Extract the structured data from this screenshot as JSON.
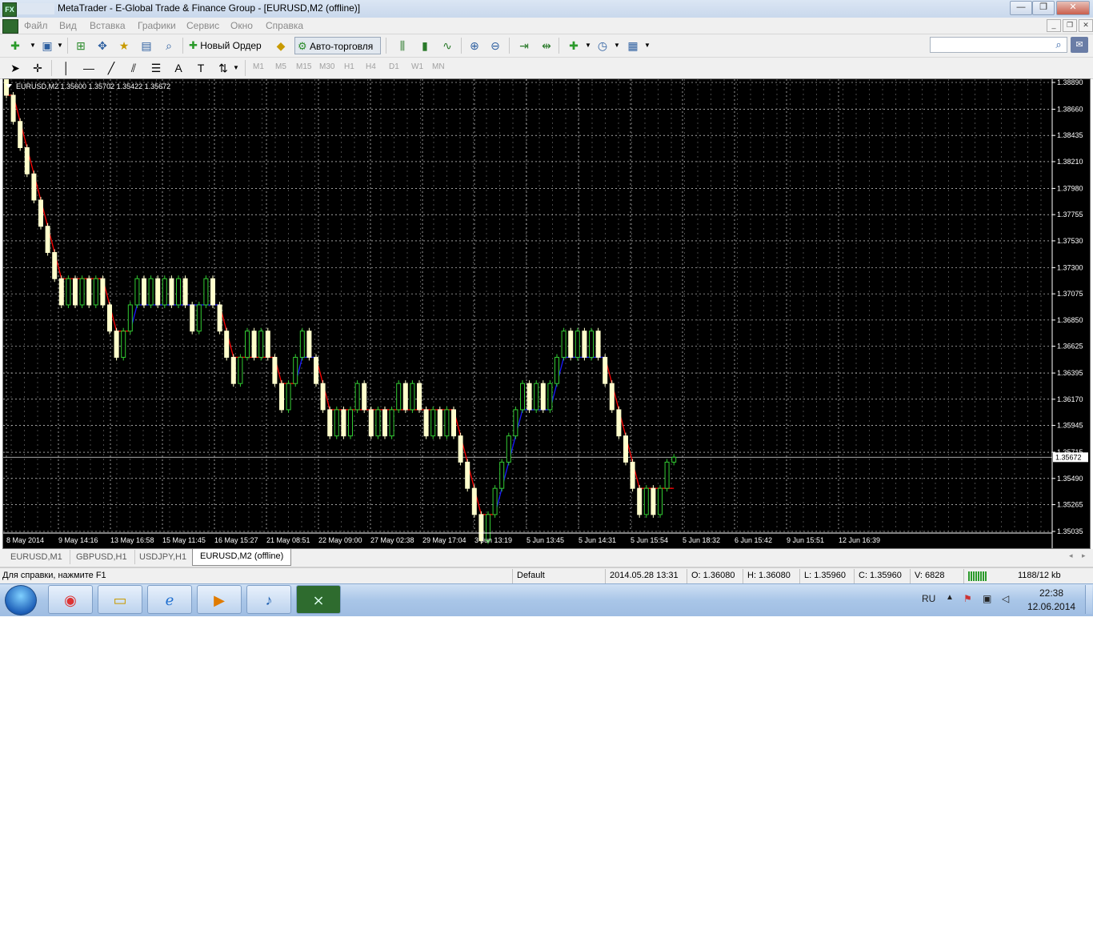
{
  "window": {
    "title": "MetaTrader - E-Global Trade & Finance Group - [EURUSD,M2 (offline)]",
    "app_icon_text": "FX",
    "controls": {
      "minimize": "—",
      "maximize": "❐",
      "close": "✕"
    }
  },
  "menu": {
    "items": [
      "Файл",
      "Вид",
      "Вставка",
      "Графики",
      "Сервис",
      "Окно",
      "Справка"
    ]
  },
  "toolbar": {
    "new_order": "Новый Ордер",
    "autotrading": "Авто-торговля",
    "search_placeholder": ""
  },
  "timeframes": [
    "M1",
    "M5",
    "M15",
    "M30",
    "H1",
    "H4",
    "D1",
    "W1",
    "MN"
  ],
  "chart": {
    "header": "EURUSD,M2  1.35600 1.35702 1.35422 1.35672",
    "current_price": "1.35672",
    "y_ticks": [
      "1.38890",
      "1.38660",
      "1.38435",
      "1.38210",
      "1.37980",
      "1.37755",
      "1.37530",
      "1.37300",
      "1.37075",
      "1.36850",
      "1.36625",
      "1.36395",
      "1.36170",
      "1.35945",
      "1.35715",
      "1.35490",
      "1.35265",
      "1.35035"
    ],
    "x_ticks": [
      "8 May 2014",
      "9 May 14:16",
      "13 May 16:58",
      "15 May 11:45",
      "16 May 15:27",
      "21 May 08:51",
      "22 May 09:00",
      "27 May 02:38",
      "29 May 17:04",
      "3 Jun 13:19",
      "5 Jun 13:45",
      "5 Jun 14:31",
      "5 Jun 15:54",
      "5 Jun 18:32",
      "6 Jun 15:42",
      "9 Jun 15:51",
      "12 Jun 16:39"
    ],
    "colors": {
      "background": "#000000",
      "bull": "#ffffcc",
      "bull_border": "#33cc33",
      "bear": "#ffffcc",
      "line_down": "#ff0000",
      "line_up": "#1a1aff",
      "grid": "#ffffff"
    }
  },
  "tabs": [
    "EURUSD,M1",
    "GBPUSD,H1",
    "USDJPY,H1",
    "EURUSD,M2 (offline)"
  ],
  "active_tab": 3,
  "status": {
    "help": "Для справки, нажмите F1",
    "profile": "Default",
    "datetime": "2014.05.28 13:31",
    "open": "O: 1.36080",
    "high": "H: 1.36080",
    "low": "L: 1.35960",
    "close": "C: 1.35960",
    "volume": "V: 6828",
    "traffic": "1188/12 kb"
  },
  "taskbar": {
    "lang": "RU",
    "time": "22:38",
    "date": "12.06.2014"
  },
  "chart_data": {
    "type": "candlestick",
    "ylim": [
      1.35035,
      1.3889
    ],
    "brick_size": 0.00225,
    "closes": [
      1.3878,
      1.38555,
      1.3833,
      1.38105,
      1.3788,
      1.37655,
      1.3743,
      1.37205,
      1.3698,
      1.37205,
      1.3698,
      1.37205,
      1.3698,
      1.37205,
      1.3698,
      1.36755,
      1.3653,
      1.36755,
      1.3698,
      1.37205,
      1.3698,
      1.37205,
      1.3698,
      1.37205,
      1.3698,
      1.37205,
      1.3698,
      1.36755,
      1.3698,
      1.37205,
      1.3698,
      1.36755,
      1.3653,
      1.36305,
      1.3653,
      1.36755,
      1.3653,
      1.36755,
      1.3653,
      1.36305,
      1.3608,
      1.36305,
      1.3653,
      1.36755,
      1.3653,
      1.36305,
      1.3608,
      1.35855,
      1.3608,
      1.35855,
      1.3608,
      1.36305,
      1.3608,
      1.35855,
      1.3608,
      1.35855,
      1.3608,
      1.36305,
      1.3608,
      1.36305,
      1.3608,
      1.35855,
      1.3608,
      1.35855,
      1.3608,
      1.35855,
      1.3563,
      1.35405,
      1.3518,
      1.34955,
      1.3518,
      1.35405,
      1.3563,
      1.35855,
      1.3608,
      1.36305,
      1.3608,
      1.36305,
      1.3608,
      1.36305,
      1.3653,
      1.36755,
      1.3653,
      1.36755,
      1.3653,
      1.36755,
      1.3653,
      1.36305,
      1.3608,
      1.35855,
      1.3563,
      1.35405,
      1.3518,
      1.35405,
      1.3518,
      1.35405,
      1.3563,
      1.35672
    ],
    "notes": "Renko-style bricks with red/blue stepped trend line"
  }
}
